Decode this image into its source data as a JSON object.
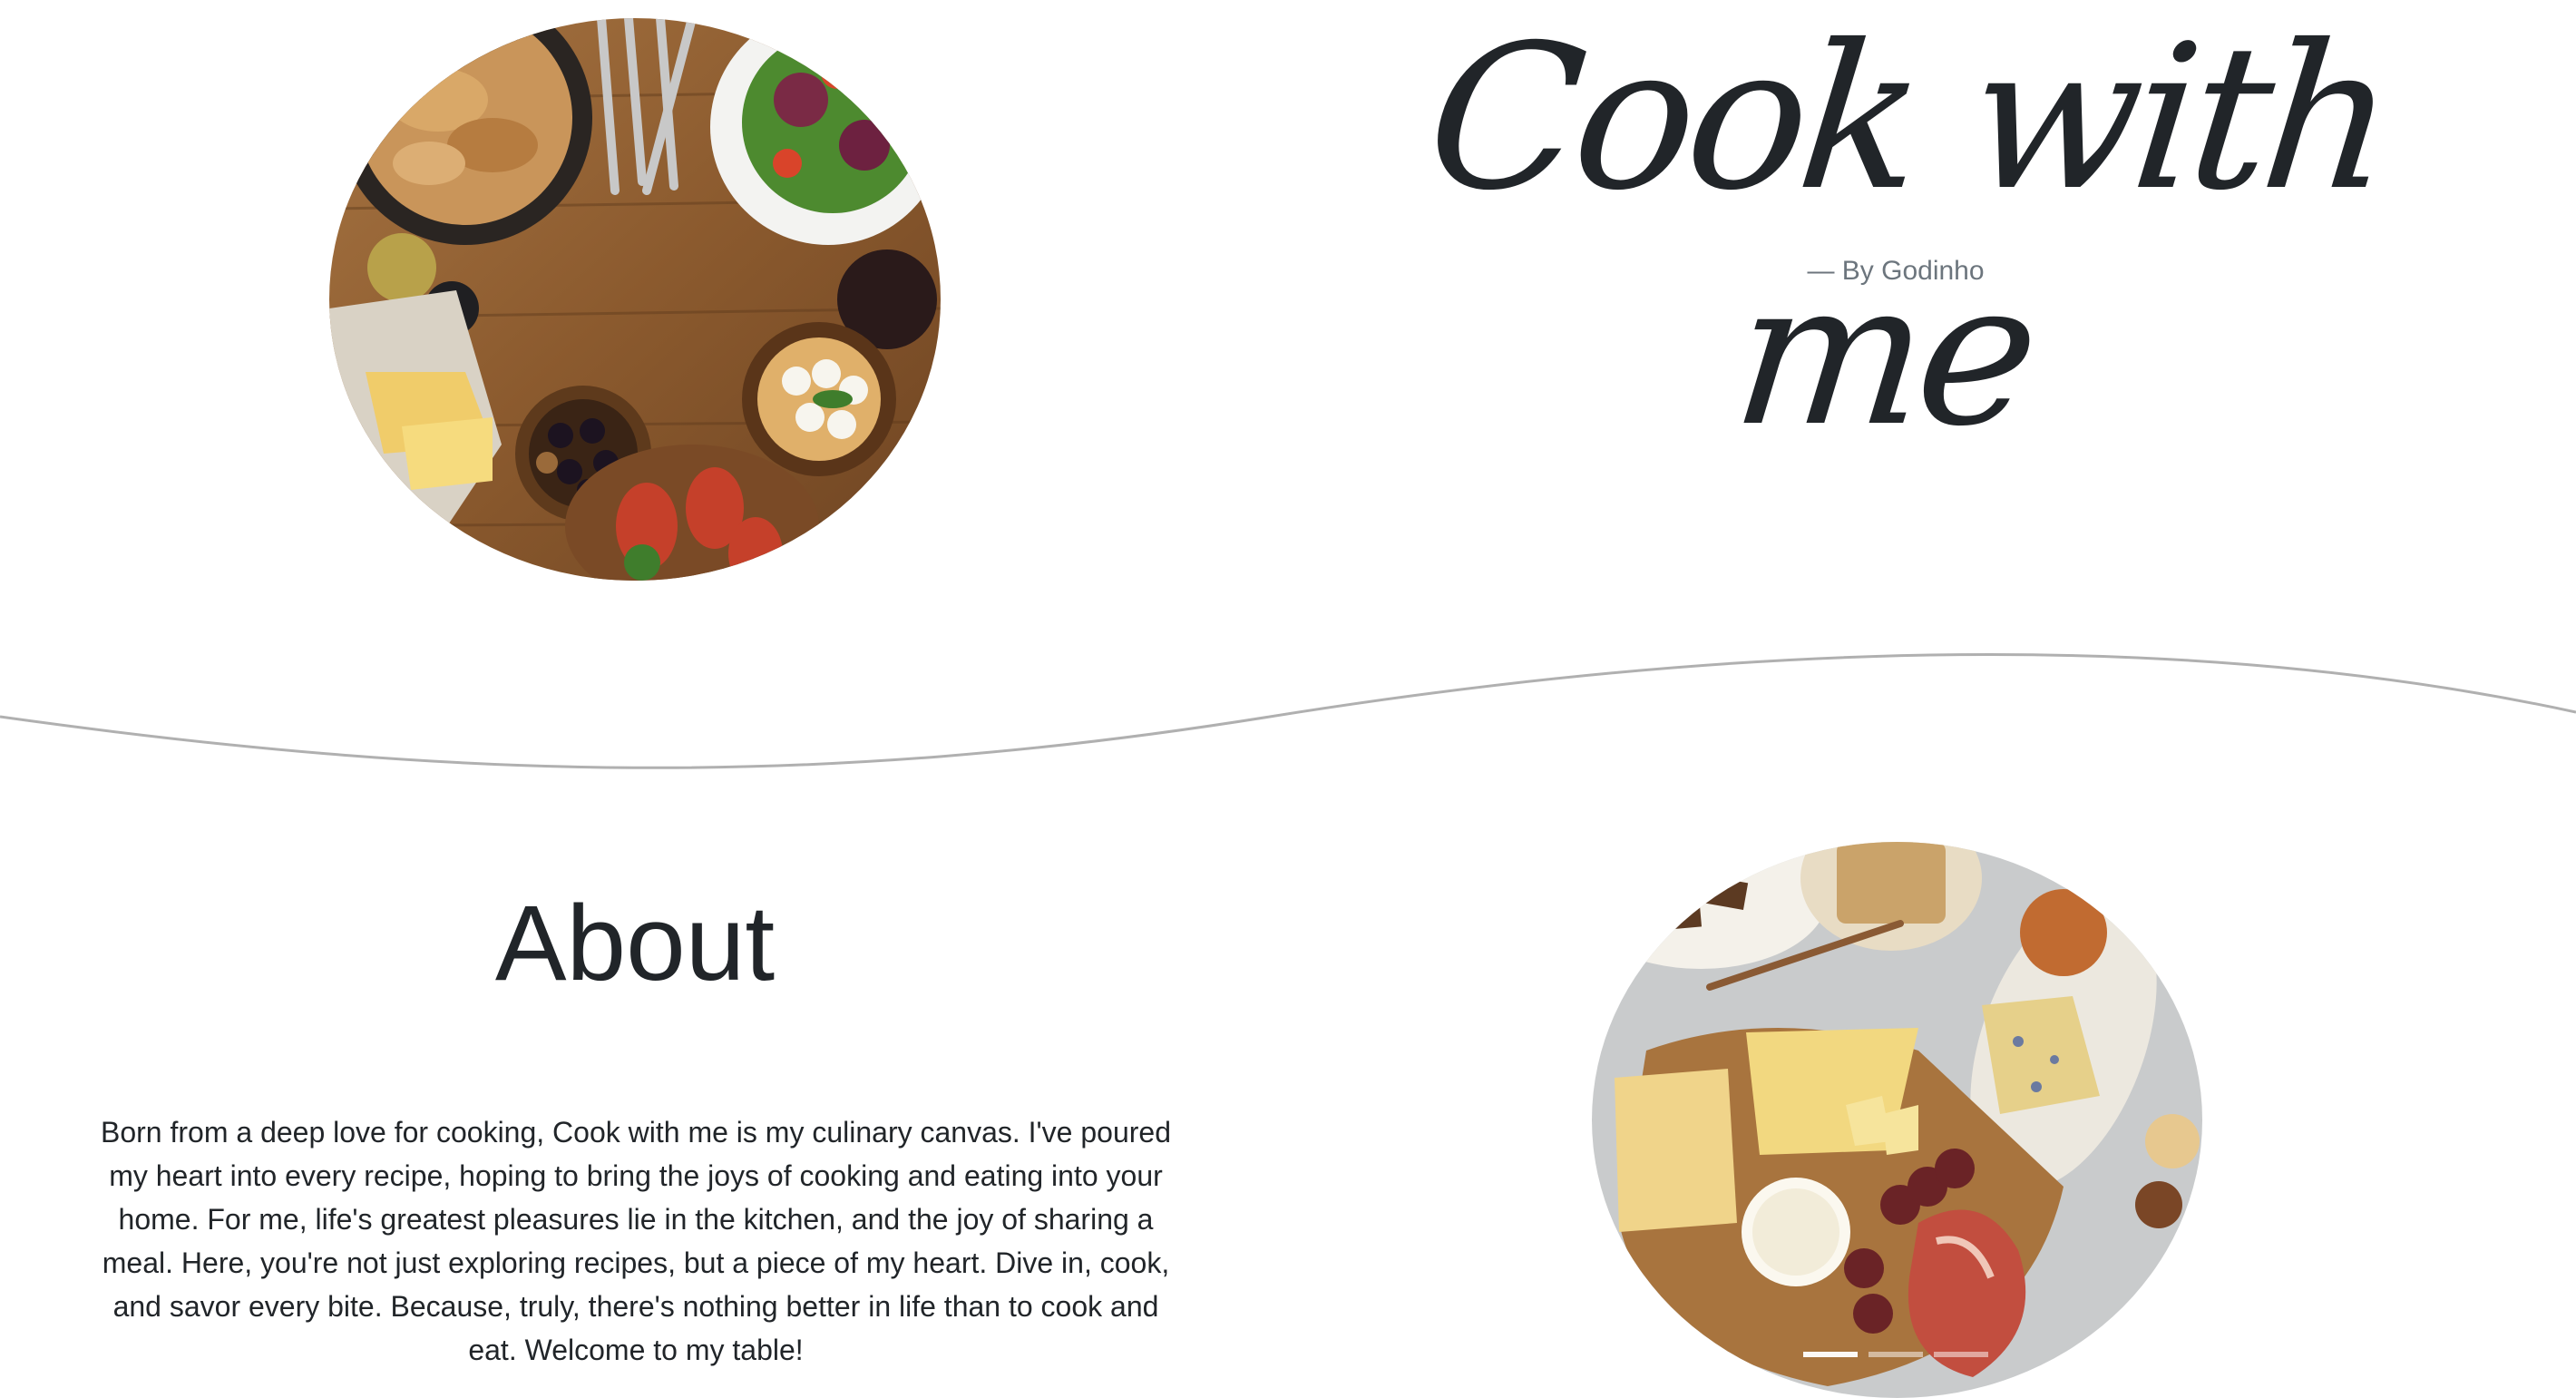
{
  "hero": {
    "title": "Cook with me",
    "byline": "— By Godinho",
    "image_icon": "food-platter-image"
  },
  "about": {
    "heading": "About",
    "text": "Born from a deep love for cooking, Cook with me is my culinary canvas. I've poured my heart into every recipe, hoping to bring the joys of cooking and eating into your home. For me, life's greatest pleasures lie in the kitchen, and the joy of sharing a meal. Here, you're not just exploring recipes, but a piece of my heart. Dive in, cook, and savor every bite. Because, truly, there's nothing better in life than to cook and eat. Welcome to my table!",
    "image_icon": "cheese-board-image"
  },
  "carousel": {
    "slide_count": 3,
    "active_index": 0
  },
  "colors": {
    "text": "#212529",
    "muted": "#6c757d",
    "wave": "#b0b0b0"
  }
}
